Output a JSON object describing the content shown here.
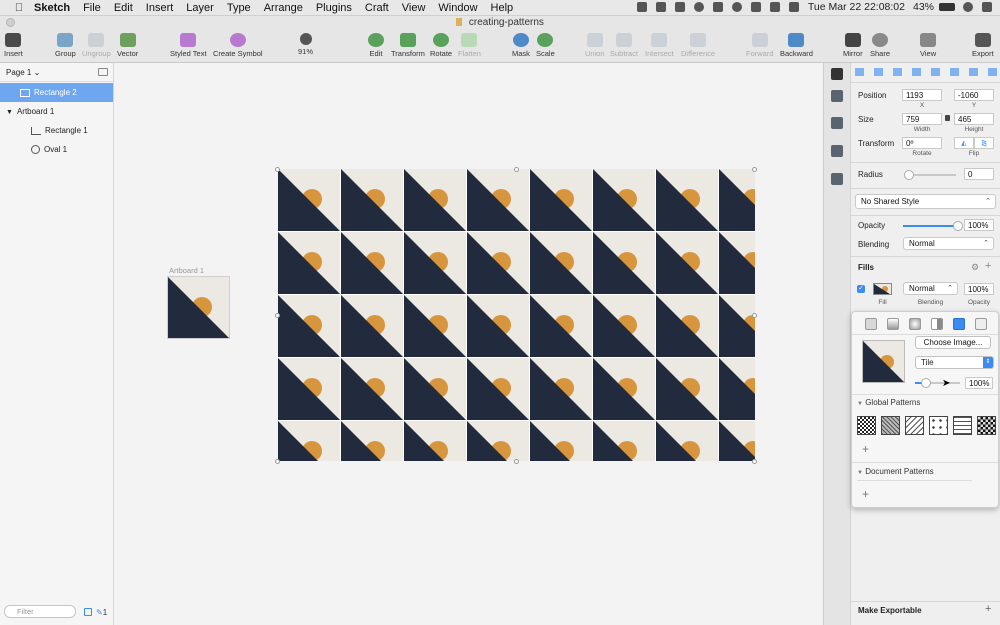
{
  "menubar": {
    "app": "Sketch",
    "items": [
      "File",
      "Edit",
      "Insert",
      "Layer",
      "Type",
      "Arrange",
      "Plugins",
      "Craft",
      "View",
      "Window",
      "Help"
    ],
    "clock": "Tue Mar 22  22:08:02",
    "battery": "43%"
  },
  "window": {
    "title": "creating-patterns"
  },
  "toolbar": {
    "insert": "Insert",
    "group": "Group",
    "ungroup": "Ungroup",
    "vector": "Vector",
    "styled_text": "Styled Text",
    "create_symbol": "Create Symbol",
    "zoom": "91%",
    "edit": "Edit",
    "transform": "Transform",
    "rotate": "Rotate",
    "flatten": "Flatten",
    "mask": "Mask",
    "scale": "Scale",
    "union": "Union",
    "subtract": "Subtract",
    "intersect": "Intersect",
    "difference": "Difference",
    "forward": "Forward",
    "backward": "Backward",
    "mirror": "Mirror",
    "share": "Share",
    "view": "View",
    "export": "Export"
  },
  "layers": {
    "page": "Page 1",
    "items": [
      {
        "label": "Rectangle 2",
        "selected": true
      },
      {
        "label": "Artboard 1",
        "selected": false
      },
      {
        "label": "Rectangle 1",
        "selected": false
      },
      {
        "label": "Oval 1",
        "selected": false
      }
    ],
    "filter_placeholder": "Filter",
    "badge": "1"
  },
  "canvas": {
    "artboard_label": "Artboard 1",
    "columns": 8,
    "rows": 5
  },
  "inspector": {
    "position_label": "Position",
    "x": "1193",
    "y": "-1060",
    "x_label": "X",
    "y_label": "Y",
    "size_label": "Size",
    "width": "759",
    "height": "465",
    "width_label": "Width",
    "height_label": "Height",
    "transform_label": "Transform",
    "rotate": "0º",
    "rotate_label": "Rotate",
    "flip_label": "Flip",
    "radius_label": "Radius",
    "radius": "0",
    "shared_style": "No Shared Style",
    "opacity_label": "Opacity",
    "opacity": "100%",
    "opacity_fraction": 1.0,
    "blending_label": "Blending",
    "blending": "Normal",
    "fills_label": "Fills",
    "fill_label": "Fill",
    "fill_blending": "Normal",
    "fill_opacity": "100%",
    "fill_col_fill": "Fill",
    "fill_col_blending": "Blending",
    "fill_col_opacity": "Opacity",
    "make_exportable": "Make Exportable"
  },
  "popover": {
    "choose_image": "Choose Image...",
    "mode": "Tile",
    "scale": "100%",
    "scale_fraction": 0.25,
    "global_patterns": "Global Patterns",
    "document_patterns": "Document Patterns"
  },
  "colors": {
    "navy": "#222a3d",
    "gold": "#d7963d",
    "cream": "#ece8e2",
    "accent": "#3a8cf2"
  }
}
